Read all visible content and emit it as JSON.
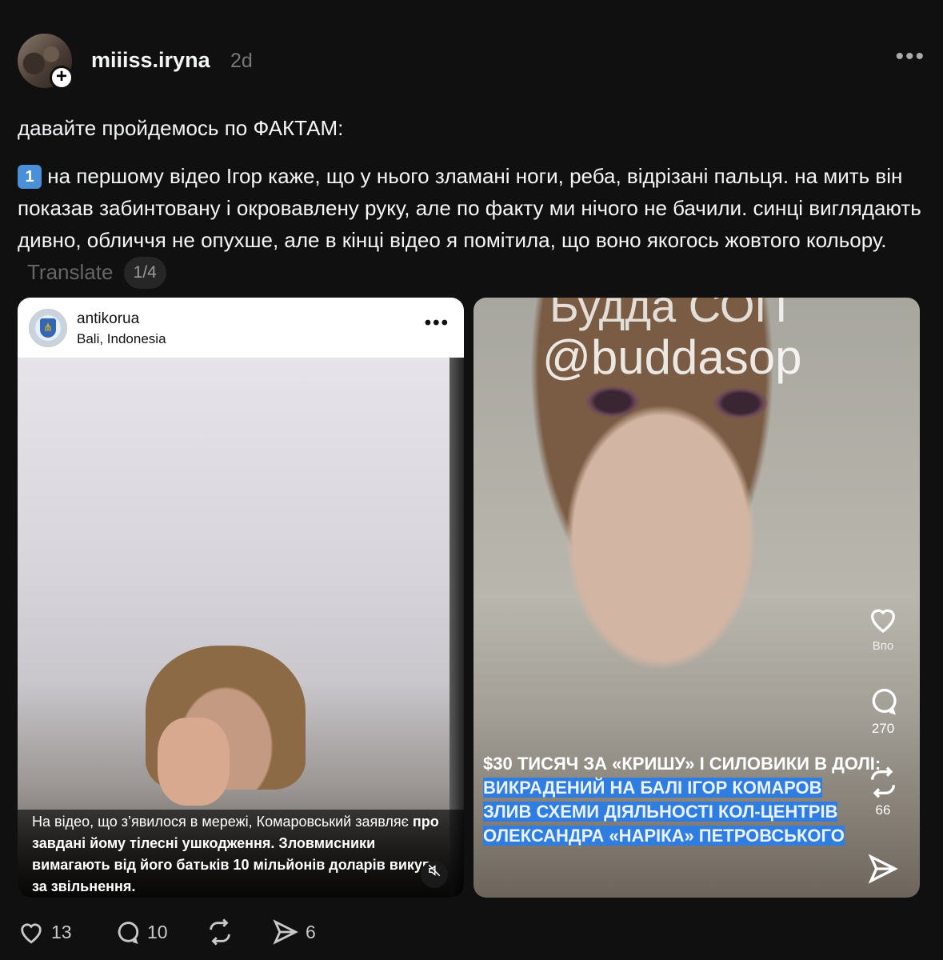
{
  "post": {
    "username": "miiiss.iryna",
    "time": "2d",
    "paragraph1": "давайте пройдемось по ФАКТАМ:",
    "item_number": "1",
    "paragraph2": "на першому відео Ігор каже, що у нього зламані ноги, реба, відрізані пальця. на мить він показав забинтовану і окровавлену руку, але по факту ми нічого не бачили. синці виглядають дивно, обличчя не опухше, але в кінці відео я помітила, що воно якогось жовтого кольору.",
    "translate": "Translate",
    "pager": "1/4"
  },
  "card1": {
    "account": "antikorua",
    "location": "Bali, Indonesia",
    "caption_normal_1": "На відео, що з’явилося в мережі, Комаровський заявляє ",
    "caption_bold_1": "про завдані йому тілесні ушкодження. Зловмисники вимагають від його батьків 10 мільйонів доларів викупу за звільнення."
  },
  "card2": {
    "handle_top": "Будда СОП",
    "handle": "@buddasop",
    "headline_plain": "$30 ТИСЯЧ ЗА «КРИШУ» І СИЛОВИКИ В ДОЛІ: ",
    "headline_hl_1": "ВИКРАДЕНИЙ НА БАЛІ ІГОР КОМАРОВ",
    "headline_hl_2": "ЗЛИВ СХЕМИ ДІЯЛЬНОСТІ КОЛ-ЦЕНТРІВ",
    "headline_hl_3": "ОЛЕКСАНДРА «НАРІКА» ПЕТРОВСЬКОГО",
    "like_label": "Впо",
    "comments": "270",
    "reposts": "66"
  },
  "actions": {
    "likes": "13",
    "comments": "10",
    "shares": "6"
  },
  "colors": {
    "background": "#101010",
    "highlight": "#2f7de1"
  }
}
